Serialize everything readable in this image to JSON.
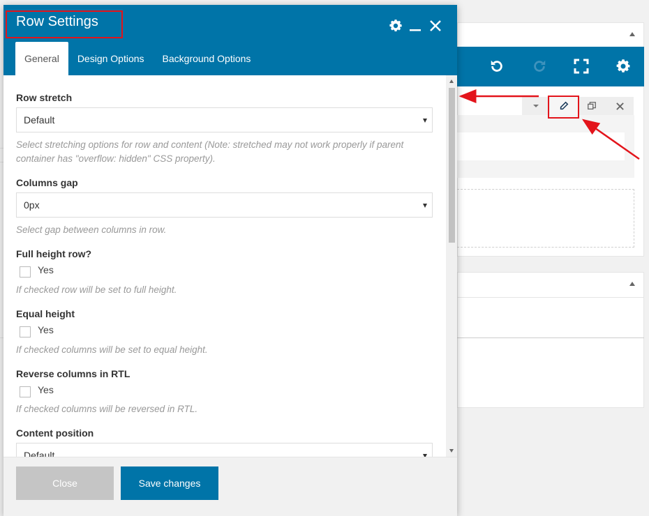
{
  "modal": {
    "title": "Row Settings",
    "tabs": [
      "General",
      "Design Options",
      "Background Options"
    ],
    "fields": {
      "row_stretch": {
        "label": "Row stretch",
        "value": "Default",
        "help": "Select stretching options for row and content (Note: stretched may not work properly if parent container has \"overflow: hidden\" CSS property)."
      },
      "columns_gap": {
        "label": "Columns gap",
        "value": "0px",
        "help": "Select gap between columns in row."
      },
      "full_height": {
        "label": "Full height row?",
        "checkbox_label": "Yes",
        "help": "If checked row will be set to full height."
      },
      "equal_height": {
        "label": "Equal height",
        "checkbox_label": "Yes",
        "help": "If checked columns will be set to equal height."
      },
      "reverse_rtl": {
        "label": "Reverse columns in RTL",
        "checkbox_label": "Yes",
        "help": "If checked columns will be reversed in RTL."
      },
      "content_position": {
        "label": "Content position",
        "value": "Default"
      }
    },
    "footer": {
      "close_label": "Close",
      "save_label": "Save changes"
    }
  },
  "colors": {
    "accent": "#0074a8",
    "highlight": "#e3141b",
    "disabled_button": "#c5c5c5"
  }
}
